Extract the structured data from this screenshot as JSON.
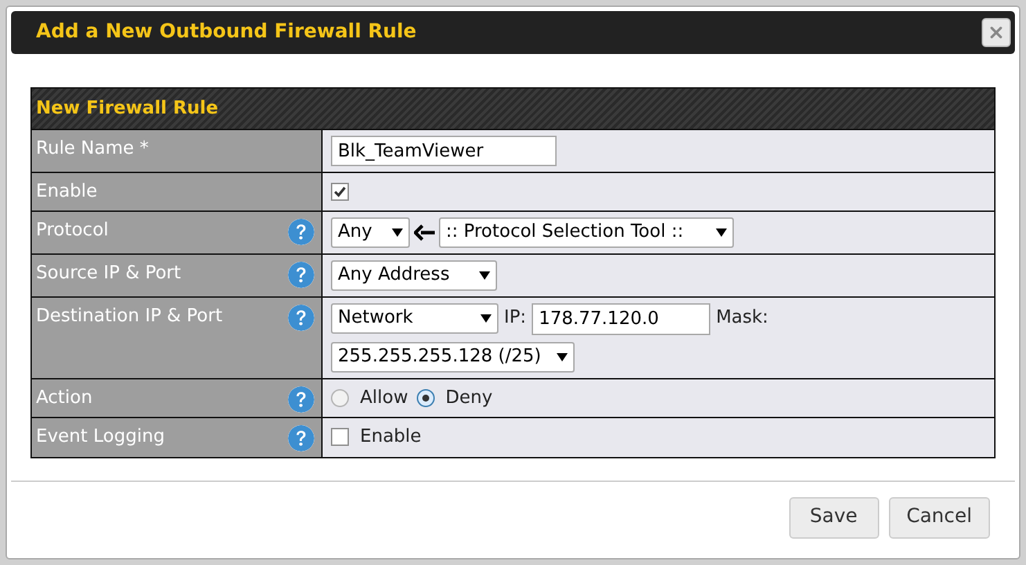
{
  "dialog": {
    "title": "Add a New Outbound Firewall Rule"
  },
  "section": {
    "title": "New Firewall Rule"
  },
  "rows": [
    {
      "kind": "text",
      "label": "Rule Name *",
      "help": false,
      "value": "Blk_TeamViewer"
    },
    {
      "kind": "checkbox",
      "label": "Enable",
      "help": false,
      "checked": true
    },
    {
      "kind": "protocol",
      "label": "Protocol",
      "help": true,
      "protocol": "Any",
      "tool": ":: Protocol Selection Tool ::"
    },
    {
      "kind": "select",
      "label": "Source IP & Port",
      "help": true,
      "value": "Any Address"
    },
    {
      "kind": "destination",
      "label": "Destination IP & Port",
      "help": true,
      "type": "Network",
      "ip_label": "IP:",
      "ip": "178.77.120.0",
      "mask_label": "Mask:",
      "mask": "255.255.255.128 (/25)"
    },
    {
      "kind": "radio",
      "label": "Action",
      "help": true,
      "options": [
        {
          "label": "Allow",
          "selected": false
        },
        {
          "label": "Deny",
          "selected": true
        }
      ]
    },
    {
      "kind": "checkbox",
      "label": "Event Logging",
      "help": true,
      "checked": false,
      "text": "Enable"
    }
  ],
  "buttons": [
    {
      "label": "Save"
    },
    {
      "label": "Cancel"
    }
  ]
}
